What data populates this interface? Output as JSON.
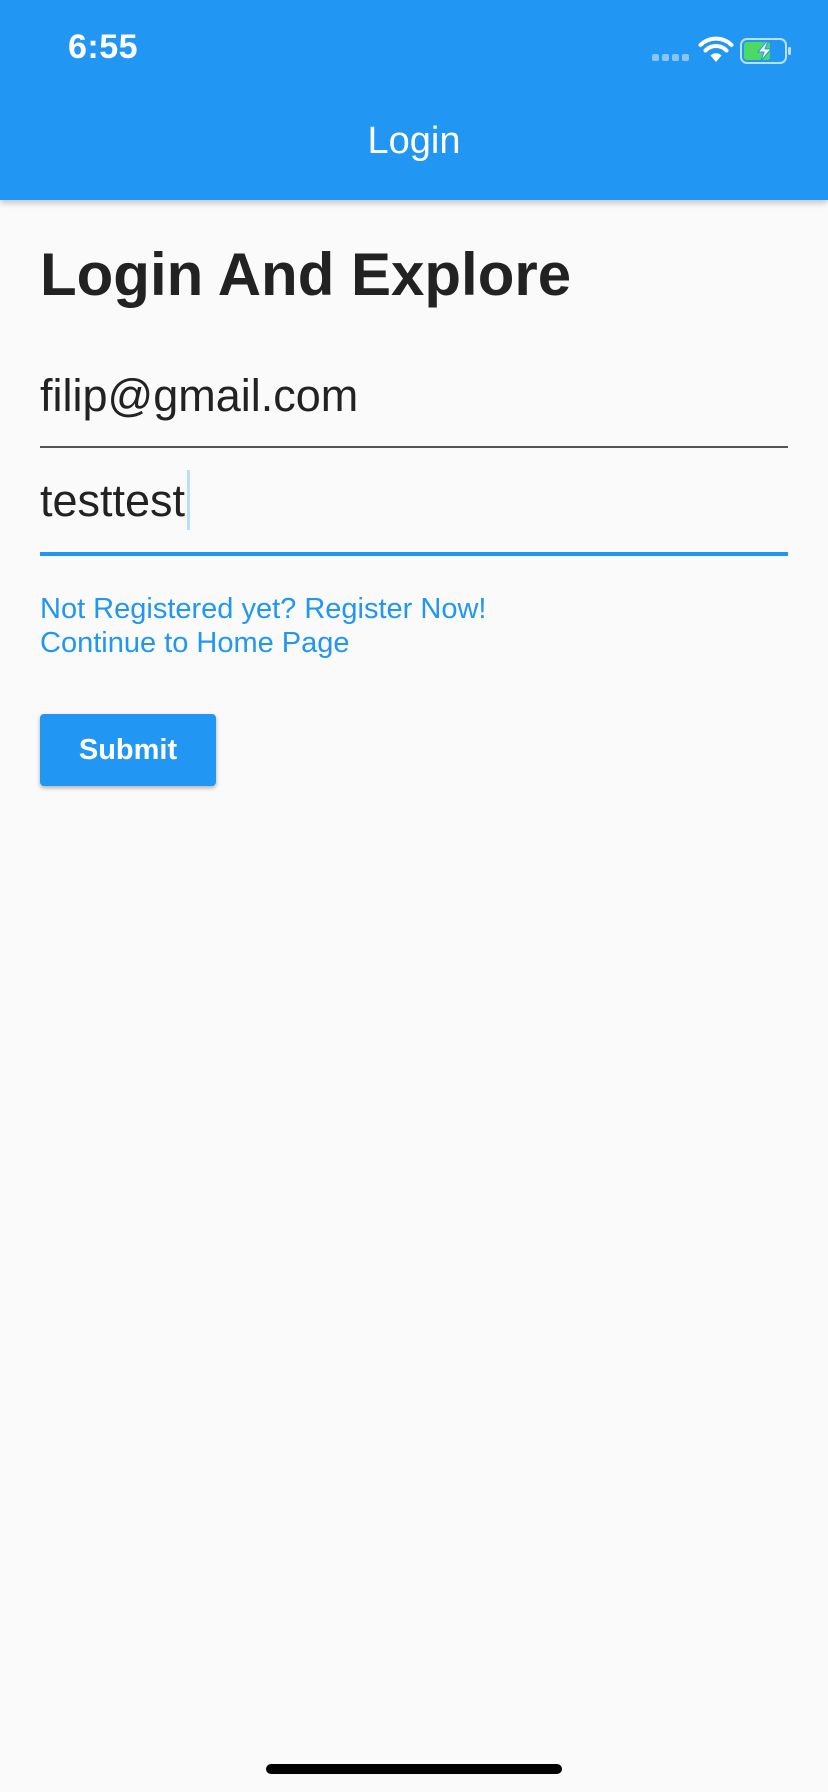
{
  "status_bar": {
    "time": "6:55",
    "icons": [
      "cellular-signal-icon",
      "wifi-icon",
      "battery-charging-icon"
    ],
    "battery_color": "#4cd964"
  },
  "app_bar": {
    "title": "Login",
    "background_color": "#2196f3"
  },
  "page": {
    "heading": "Login And Explore"
  },
  "form": {
    "email": {
      "value": "filip@gmail.com"
    },
    "password": {
      "value": "testtest"
    },
    "register_link": "Not Registered yet? Register Now!",
    "home_link": "Continue to Home Page",
    "submit_label": "Submit"
  },
  "colors": {
    "accent": "#2196f3",
    "text": "#222222",
    "background": "#fafafa"
  }
}
